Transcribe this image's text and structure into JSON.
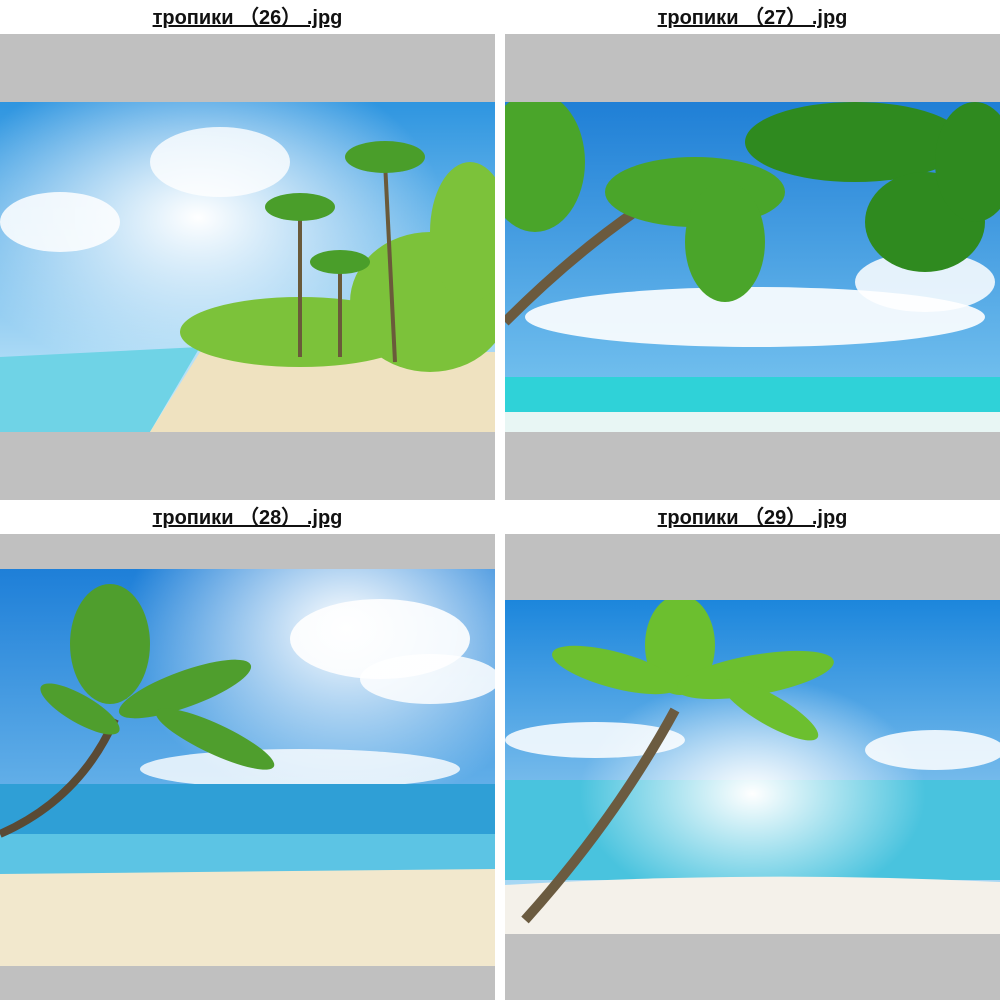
{
  "thumbnails": [
    {
      "filename": "тропики （26） .jpg",
      "icon": "tropical-beach-photo"
    },
    {
      "filename": "тропики （27） .jpg",
      "icon": "tropical-beach-photo"
    },
    {
      "filename": "тропики （28） .jpg",
      "icon": "tropical-beach-photo"
    },
    {
      "filename": "тропики （29） .jpg",
      "icon": "tropical-beach-photo"
    }
  ],
  "colors": {
    "frame_background": "#c0c0c0",
    "sky": "#3aa3e6",
    "sea": "#3fd0d8",
    "sand": "#f2e6c8",
    "palm_green": "#5fb23a"
  }
}
